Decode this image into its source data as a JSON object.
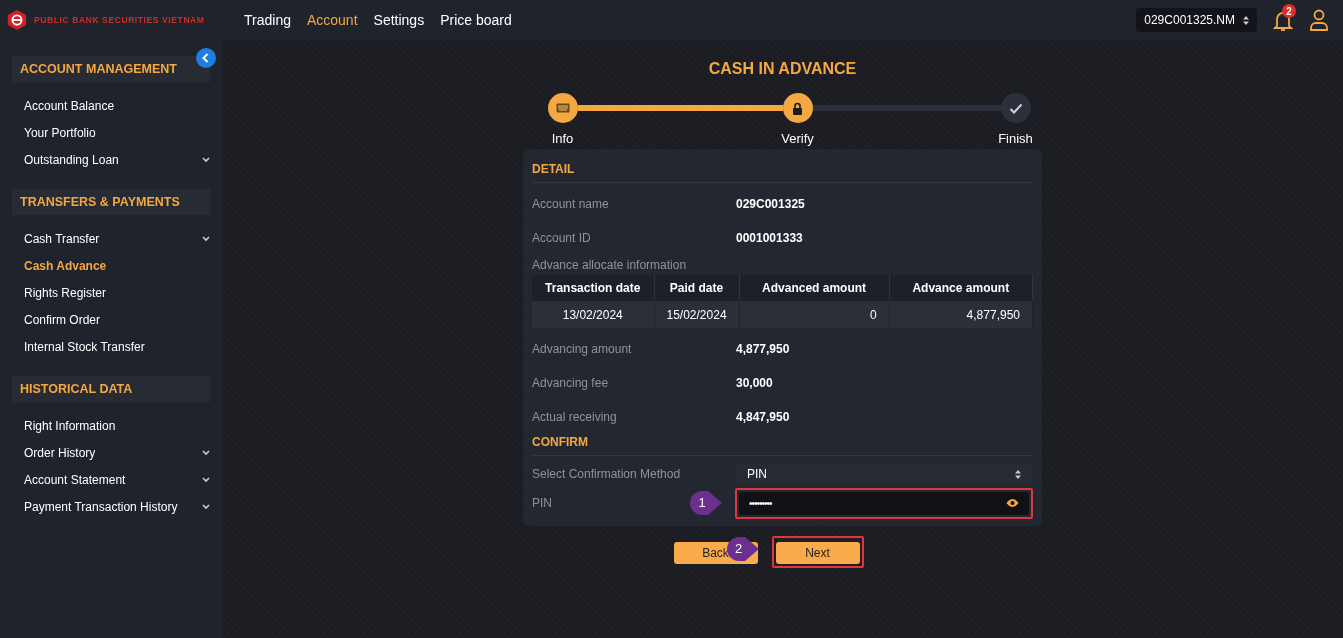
{
  "brand": {
    "name": "PUBLIC BANK SECURITIES VIETNAM"
  },
  "nav": [
    {
      "label": "Trading",
      "selected": false
    },
    {
      "label": "Account",
      "selected": true
    },
    {
      "label": "Settings",
      "selected": false
    },
    {
      "label": "Price board",
      "selected": false
    }
  ],
  "account_select": {
    "value": "029C001325.NM"
  },
  "notifications": {
    "count": "2"
  },
  "sidebar": {
    "sections": [
      {
        "title": "ACCOUNT MANAGEMENT",
        "items": [
          {
            "label": "Account Balance",
            "selected": false,
            "has_submenu": false
          },
          {
            "label": "Your Portfolio",
            "selected": false,
            "has_submenu": false
          },
          {
            "label": "Outstanding Loan",
            "selected": false,
            "has_submenu": true
          }
        ]
      },
      {
        "title": "TRANSFERS & PAYMENTS",
        "items": [
          {
            "label": "Cash Transfer",
            "selected": false,
            "has_submenu": true
          },
          {
            "label": "Cash Advance",
            "selected": true,
            "has_submenu": false
          },
          {
            "label": "Rights Register",
            "selected": false,
            "has_submenu": false
          },
          {
            "label": "Confirm Order",
            "selected": false,
            "has_submenu": false
          },
          {
            "label": "Internal Stock Transfer",
            "selected": false,
            "has_submenu": false
          }
        ]
      },
      {
        "title": "HISTORICAL DATA",
        "items": [
          {
            "label": "Right Information",
            "selected": false,
            "has_submenu": false
          },
          {
            "label": "Order History",
            "selected": false,
            "has_submenu": true
          },
          {
            "label": "Account Statement",
            "selected": false,
            "has_submenu": true
          },
          {
            "label": "Payment Transaction History",
            "selected": false,
            "has_submenu": true
          }
        ]
      }
    ]
  },
  "page": {
    "title": "CASH IN ADVANCE"
  },
  "steps": [
    {
      "label": "Info",
      "reached": true
    },
    {
      "label": "Verify",
      "reached": true
    },
    {
      "label": "Finish",
      "reached": false
    }
  ],
  "detail": {
    "title": "DETAIL",
    "fields_top": [
      {
        "label": "Account name",
        "value": "029C001325"
      },
      {
        "label": "Account ID",
        "value": "0001001333"
      }
    ],
    "table_caption": "Advance allocate information",
    "table": {
      "columns": [
        "Transaction date",
        "Paid date",
        "Advanced amount",
        "Advance amount"
      ],
      "rows": [
        [
          "13/02/2024",
          "15/02/2024",
          "0",
          "4,877,950"
        ]
      ]
    },
    "fields_bottom": [
      {
        "label": "Advancing amount",
        "value": "4,877,950"
      },
      {
        "label": "Advancing fee",
        "value": "30,000"
      },
      {
        "label": "Actual receiving",
        "value": "4,847,950"
      }
    ]
  },
  "confirm": {
    "title": "CONFIRM",
    "method_label": "Select Confirmation Method",
    "method_value": "PIN",
    "pin_label": "PIN",
    "pin_value": "•••••••••",
    "pin_highlighted": true
  },
  "buttons": [
    {
      "label": "Back",
      "highlighted": false
    },
    {
      "label": "Next",
      "highlighted": true
    }
  ],
  "annotations": [
    {
      "label": "1"
    },
    {
      "label": "2"
    }
  ]
}
